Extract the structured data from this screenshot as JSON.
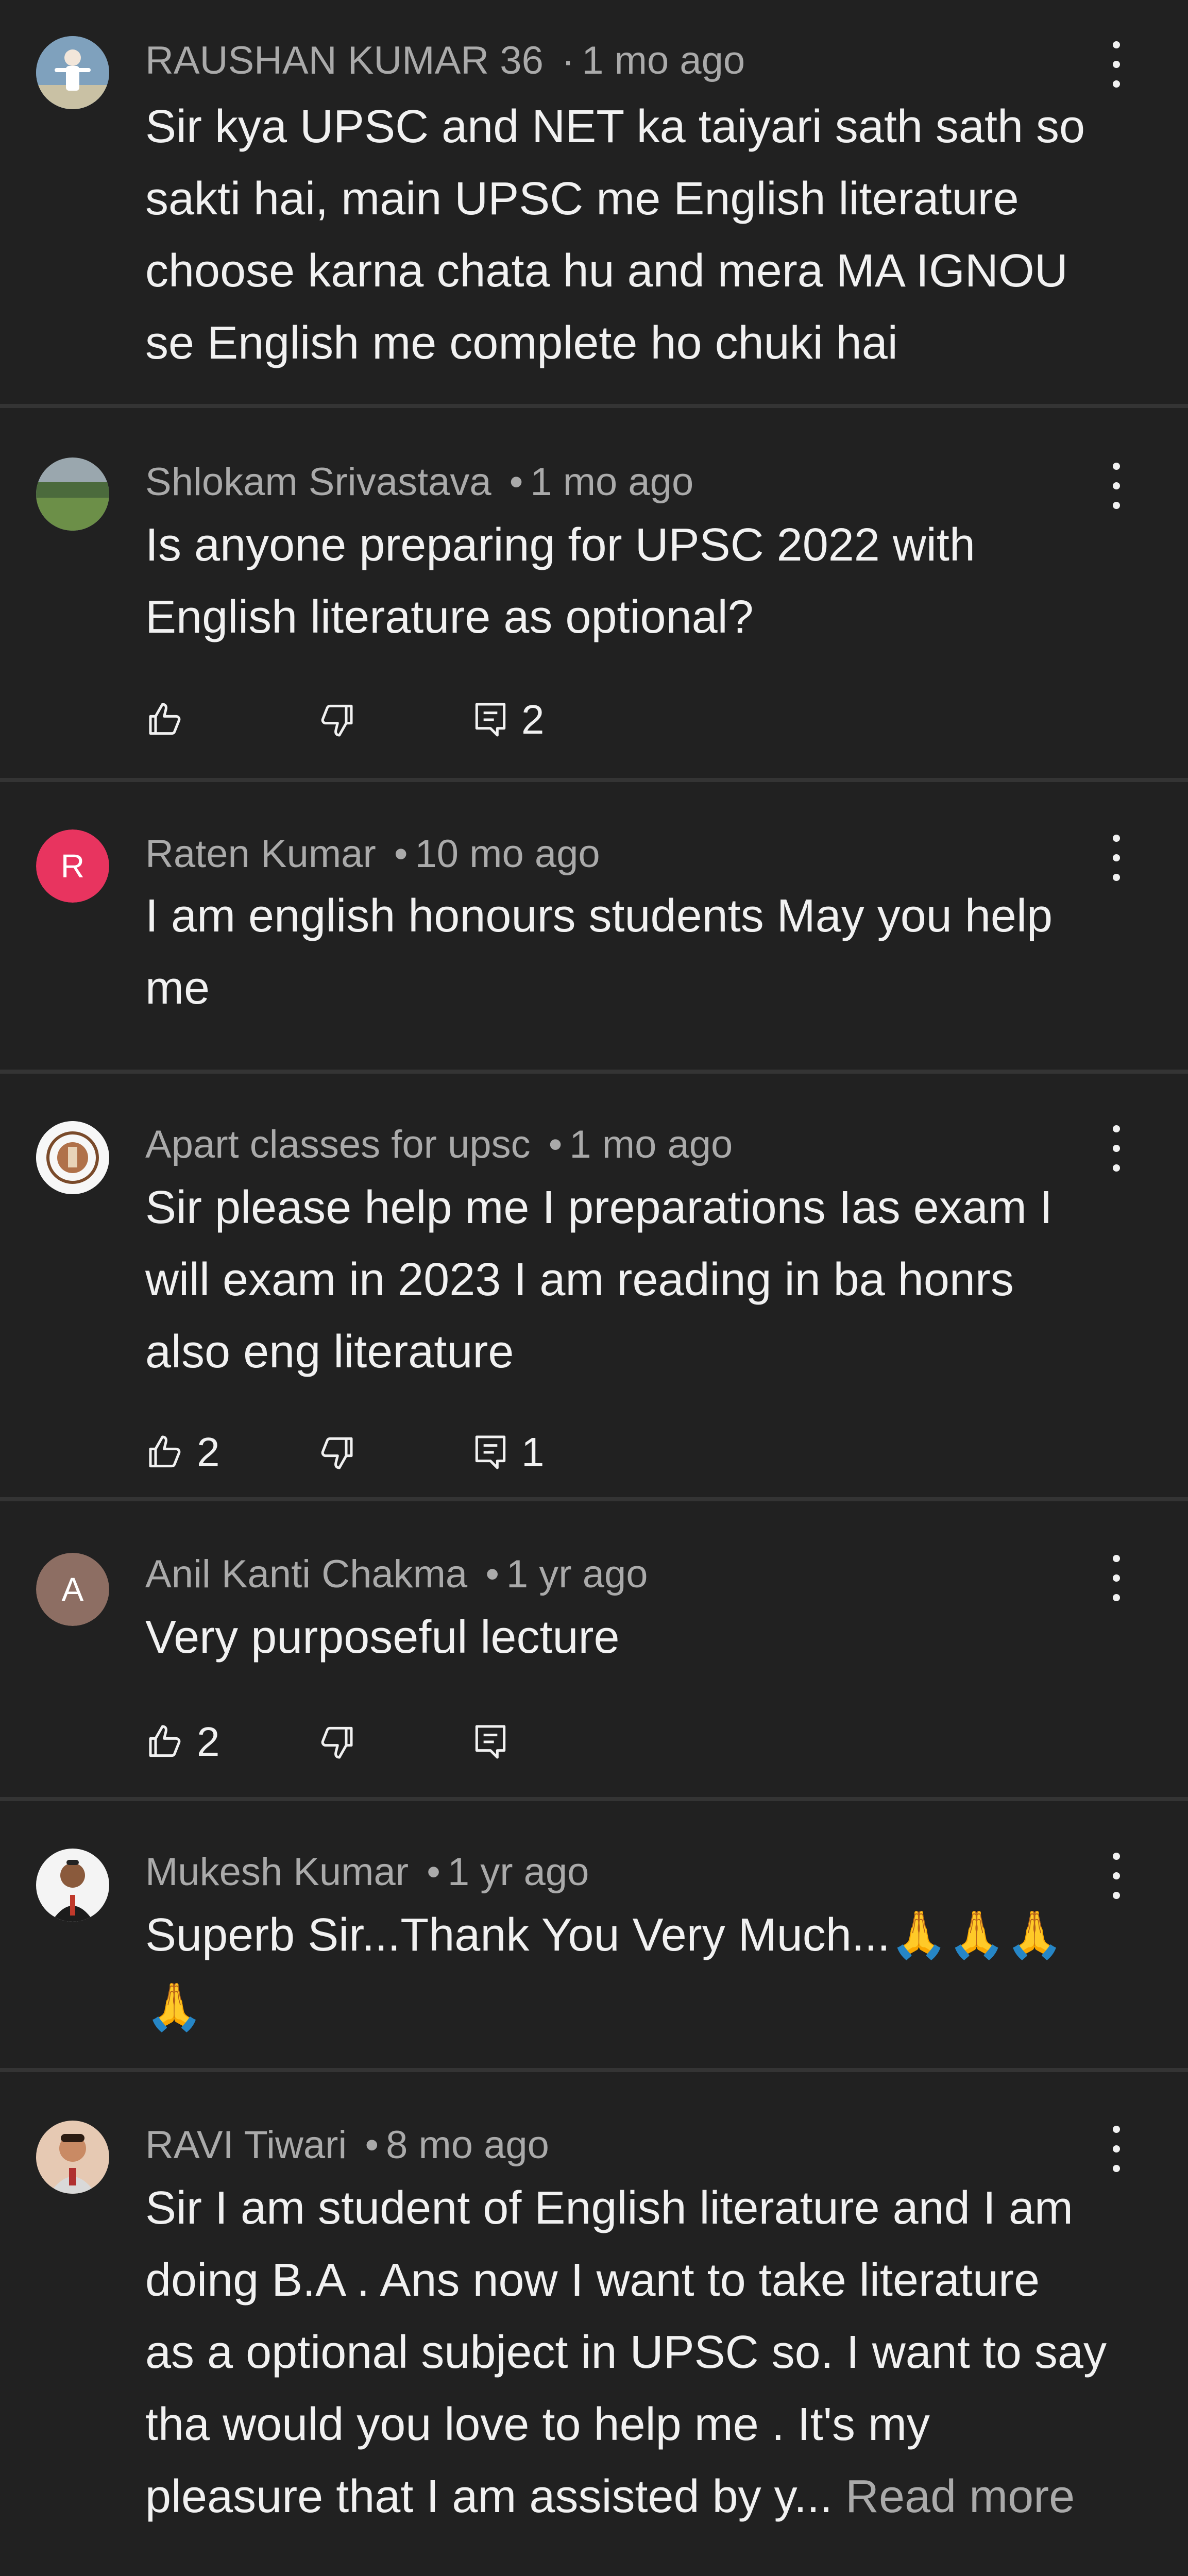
{
  "comments": [
    {
      "author": "RAUSHAN KUMAR 36",
      "time": "1 mo ago",
      "separator": "·",
      "avatar": "photo",
      "text": "Sir kya UPSC and NET ka taiyari sath sath so\nsakti hai, main UPSC me English literature\nchoose karna chata hu and mera MA IGNOU\nse English me complete ho chuki hai"
    },
    {
      "author": "Shlokam Srivastava",
      "time": "1 mo ago",
      "separator": "•",
      "avatar": "photo",
      "text": "Is anyone preparing for UPSC 2022 with\nEnglish literature as optional?",
      "likes": "",
      "replies": "2"
    },
    {
      "author": "Raten Kumar",
      "time": "10 mo ago",
      "separator": "•",
      "avatar_letter": "R",
      "avatar_color": "#e8345f",
      "text": "I am english honours students May you help\nme"
    },
    {
      "author": "Apart classes for upsc",
      "time": "1 mo ago",
      "separator": "•",
      "avatar": "emblem",
      "text": "Sir please help me  I preparations Ias exam I\nwill exam in 2023 I am reading in ba honrs\nalso eng literature",
      "likes": "2",
      "replies": "1"
    },
    {
      "author": "Anil Kanti Chakma",
      "time": "1 yr ago",
      "separator": "•",
      "avatar_letter": "A",
      "avatar_color": "#8d6e63",
      "text": "Very purposeful lecture",
      "likes": "2",
      "replies": ""
    },
    {
      "author": "Mukesh Kumar",
      "time": "1 yr ago",
      "separator": "•",
      "avatar": "photo",
      "text": "Superb Sir...Thank You Very Much...🙏🙏🙏\n🙏"
    },
    {
      "author": "RAVI Tiwari",
      "time": "8 mo ago",
      "separator": "•",
      "avatar": "photo",
      "text": "Sir I am student of English literature and I am\ndoing B.A . Ans now I want to take literature\nas a optional subject in UPSC so. I want to say\ntha would you love to help me . It's my\npleasure that  I am assisted by y... ",
      "read_more": "Read more"
    }
  ],
  "icons": {
    "like": "thumbs-up-icon",
    "dislike": "thumbs-down-icon",
    "reply": "reply-comment-icon",
    "menu": "more-vertical-icon"
  },
  "colors": {
    "background": "#212121",
    "divider": "#343434",
    "primary_text": "#f1f1f1",
    "secondary_text": "#aaaaaa"
  }
}
